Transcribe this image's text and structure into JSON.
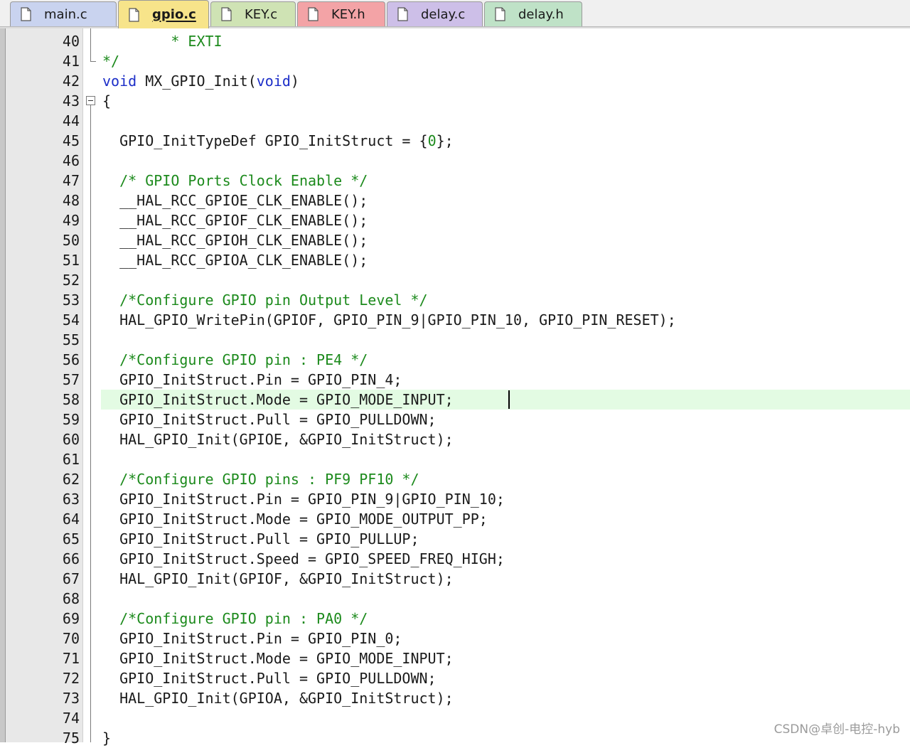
{
  "tabs": [
    {
      "label": "main.c",
      "bg": "#c9d3ef",
      "active": false
    },
    {
      "label": "gpio.c",
      "bg": "#f7e48a",
      "active": true
    },
    {
      "label": "KEY.c",
      "bg": "#cfe3b4",
      "active": false
    },
    {
      "label": "KEY.h",
      "bg": "#f3a3a6",
      "active": false
    },
    {
      "label": "delay.c",
      "bg": "#cdbfe8",
      "active": false
    },
    {
      "label": "delay.h",
      "bg": "#bfe2c7",
      "active": false
    }
  ],
  "editor": {
    "current_line": 58,
    "lines": [
      {
        "num": "40",
        "segments": [
          {
            "t": "        * EXTI",
            "c": "comment"
          }
        ]
      },
      {
        "num": "41",
        "segments": [
          {
            "t": "*/",
            "c": "comment"
          }
        ]
      },
      {
        "num": "42",
        "segments": [
          {
            "t": "void",
            "c": "kw"
          },
          {
            "t": " MX_GPIO_Init(",
            "c": "plain"
          },
          {
            "t": "void",
            "c": "kw"
          },
          {
            "t": ")",
            "c": "plain"
          }
        ]
      },
      {
        "num": "43",
        "segments": [
          {
            "t": "{",
            "c": "plain"
          }
        ]
      },
      {
        "num": "44",
        "segments": []
      },
      {
        "num": "45",
        "segments": [
          {
            "t": "  GPIO_InitTypeDef GPIO_InitStruct = {",
            "c": "plain"
          },
          {
            "t": "0",
            "c": "num"
          },
          {
            "t": "};",
            "c": "plain"
          }
        ]
      },
      {
        "num": "46",
        "segments": []
      },
      {
        "num": "47",
        "segments": [
          {
            "t": "  /* GPIO Ports Clock Enable */",
            "c": "comment"
          }
        ]
      },
      {
        "num": "48",
        "segments": [
          {
            "t": "  __HAL_RCC_GPIOE_CLK_ENABLE();",
            "c": "plain"
          }
        ]
      },
      {
        "num": "49",
        "segments": [
          {
            "t": "  __HAL_RCC_GPIOF_CLK_ENABLE();",
            "c": "plain"
          }
        ]
      },
      {
        "num": "50",
        "segments": [
          {
            "t": "  __HAL_RCC_GPIOH_CLK_ENABLE();",
            "c": "plain"
          }
        ]
      },
      {
        "num": "51",
        "segments": [
          {
            "t": "  __HAL_RCC_GPIOA_CLK_ENABLE();",
            "c": "plain"
          }
        ]
      },
      {
        "num": "52",
        "segments": []
      },
      {
        "num": "53",
        "segments": [
          {
            "t": "  /*Configure GPIO pin Output Level */",
            "c": "comment"
          }
        ]
      },
      {
        "num": "54",
        "segments": [
          {
            "t": "  HAL_GPIO_WritePin(GPIOF, GPIO_PIN_9|GPIO_PIN_10, GPIO_PIN_RESET);",
            "c": "plain"
          }
        ]
      },
      {
        "num": "55",
        "segments": []
      },
      {
        "num": "56",
        "segments": [
          {
            "t": "  /*Configure GPIO pin : PE4 */",
            "c": "comment"
          }
        ]
      },
      {
        "num": "57",
        "segments": [
          {
            "t": "  GPIO_InitStruct.Pin = GPIO_PIN_4;",
            "c": "plain"
          }
        ]
      },
      {
        "num": "58",
        "segments": [
          {
            "t": "  GPIO_InitStruct.Mode = GPIO_MODE_INPUT;",
            "c": "plain"
          }
        ]
      },
      {
        "num": "59",
        "segments": [
          {
            "t": "  GPIO_InitStruct.Pull = GPIO_PULLDOWN;",
            "c": "plain"
          }
        ]
      },
      {
        "num": "60",
        "segments": [
          {
            "t": "  HAL_GPIO_Init(GPIOE, &GPIO_InitStruct);",
            "c": "plain"
          }
        ]
      },
      {
        "num": "61",
        "segments": []
      },
      {
        "num": "62",
        "segments": [
          {
            "t": "  /*Configure GPIO pins : PF9 PF10 */",
            "c": "comment"
          }
        ]
      },
      {
        "num": "63",
        "segments": [
          {
            "t": "  GPIO_InitStruct.Pin = GPIO_PIN_9|GPIO_PIN_10;",
            "c": "plain"
          }
        ]
      },
      {
        "num": "64",
        "segments": [
          {
            "t": "  GPIO_InitStruct.Mode = GPIO_MODE_OUTPUT_PP;",
            "c": "plain"
          }
        ]
      },
      {
        "num": "65",
        "segments": [
          {
            "t": "  GPIO_InitStruct.Pull = GPIO_PULLUP;",
            "c": "plain"
          }
        ]
      },
      {
        "num": "66",
        "segments": [
          {
            "t": "  GPIO_InitStruct.Speed = GPIO_SPEED_FREQ_HIGH;",
            "c": "plain"
          }
        ]
      },
      {
        "num": "67",
        "segments": [
          {
            "t": "  HAL_GPIO_Init(GPIOF, &GPIO_InitStruct);",
            "c": "plain"
          }
        ]
      },
      {
        "num": "68",
        "segments": []
      },
      {
        "num": "69",
        "segments": [
          {
            "t": "  /*Configure GPIO pin : PA0 */",
            "c": "comment"
          }
        ]
      },
      {
        "num": "70",
        "segments": [
          {
            "t": "  GPIO_InitStruct.Pin = GPIO_PIN_0;",
            "c": "plain"
          }
        ]
      },
      {
        "num": "71",
        "segments": [
          {
            "t": "  GPIO_InitStruct.Mode = GPIO_MODE_INPUT;",
            "c": "plain"
          }
        ]
      },
      {
        "num": "72",
        "segments": [
          {
            "t": "  GPIO_InitStruct.Pull = GPIO_PULLDOWN;",
            "c": "plain"
          }
        ]
      },
      {
        "num": "73",
        "segments": [
          {
            "t": "  HAL_GPIO_Init(GPIOA, &GPIO_InitStruct);",
            "c": "plain"
          }
        ]
      },
      {
        "num": "74",
        "segments": []
      },
      {
        "num": "75",
        "segments": [
          {
            "t": "}",
            "c": "plain"
          }
        ]
      }
    ]
  },
  "watermark": "CSDN@卓创-电控-hyb",
  "colors": {
    "keyword": "#1c2ec8",
    "comment": "#1c8a1c",
    "current_line_bg": "#e3fbe3",
    "gutter_bg": "#e8e8e8"
  }
}
